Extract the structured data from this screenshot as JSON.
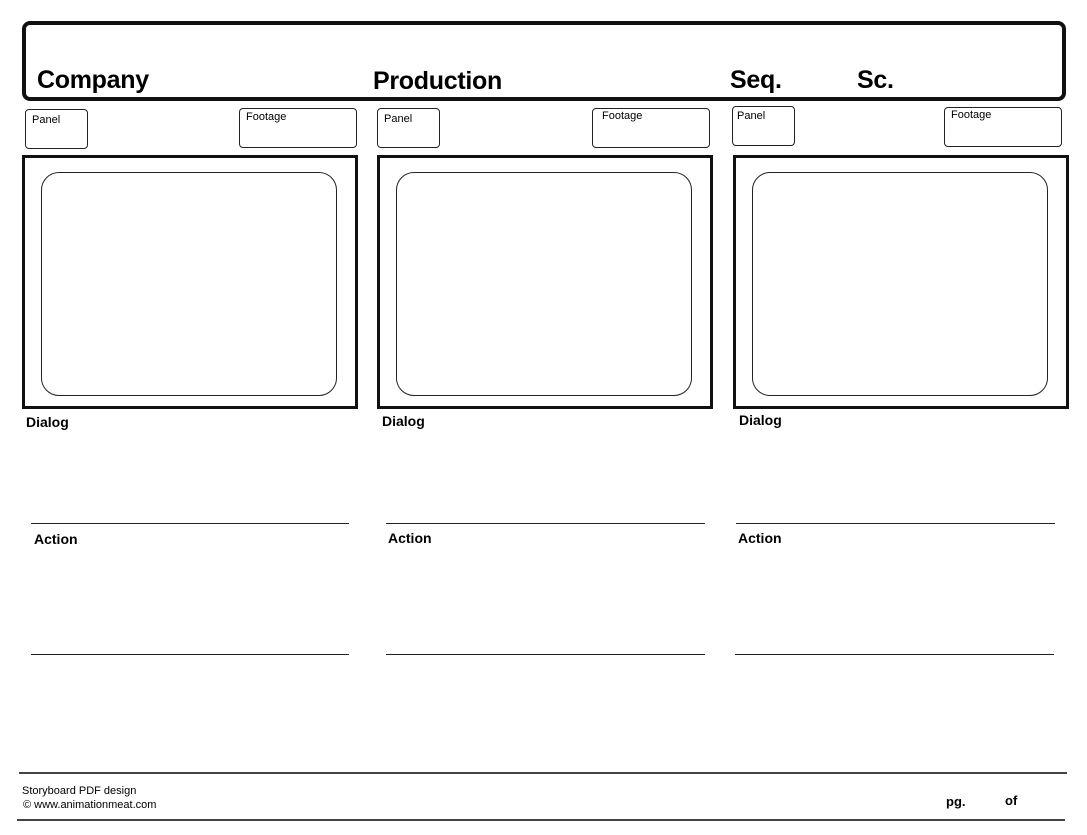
{
  "header": {
    "company_label": "Company",
    "production_label": "Production",
    "sequence_label": "Seq.",
    "scene_label": "Sc."
  },
  "panels": [
    {
      "panel_label": "Panel",
      "footage_label": "Footage",
      "dialog_label": "Dialog",
      "action_label": "Action"
    },
    {
      "panel_label": "Panel",
      "footage_label": "Footage",
      "dialog_label": "Dialog",
      "action_label": "Action"
    },
    {
      "panel_label": "Panel",
      "footage_label": "Footage",
      "dialog_label": "Dialog",
      "action_label": "Action"
    }
  ],
  "footer": {
    "design_line": "Storyboard PDF design",
    "copyright_line": "© www.animationmeat.com",
    "page_label": "pg.",
    "of_label": "of"
  }
}
